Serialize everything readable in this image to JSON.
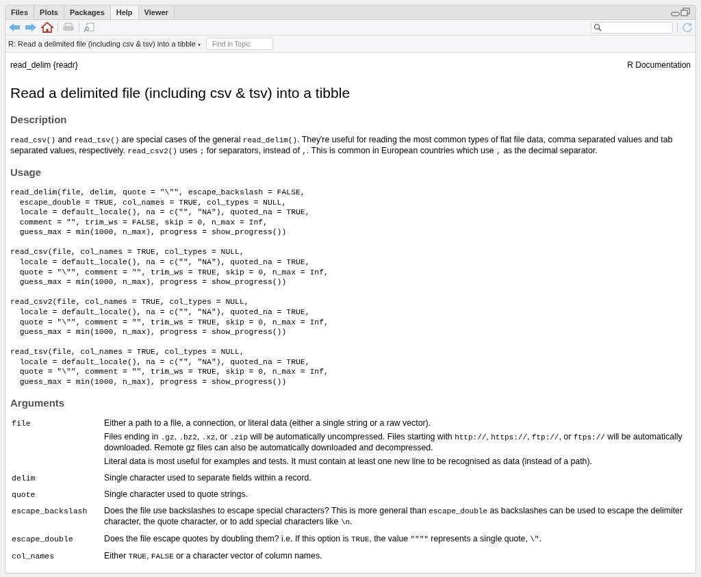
{
  "tabs": [
    {
      "label": "Files",
      "selected": false
    },
    {
      "label": "Plots",
      "selected": false
    },
    {
      "label": "Packages",
      "selected": false
    },
    {
      "label": "Help",
      "selected": true
    },
    {
      "label": "Viewer",
      "selected": false
    }
  ],
  "topic_bar": {
    "topic": "R: Read a delimited file (including csv & tsv) into a tibble",
    "caret": "▾",
    "find_placeholder": "Find in Topic"
  },
  "doc": {
    "header_left": "read_delim {readr}",
    "header_right": "R Documentation",
    "title": "Read a delimited file (including csv & tsv) into a tibble",
    "sections": [
      {
        "kind": "text",
        "heading": "Description",
        "paragraphs": [
          [
            {
              "text": "read_csv()",
              "code": true
            },
            {
              "text": " and ",
              "code": false
            },
            {
              "text": "read_tsv()",
              "code": true
            },
            {
              "text": " are special cases of the general ",
              "code": false
            },
            {
              "text": "read_delim()",
              "code": true
            },
            {
              "text": ". They're useful for reading the most common types of flat file data, comma separated values and tab separated values, respectively. ",
              "code": false
            },
            {
              "text": "read_csv2()",
              "code": true
            },
            {
              "text": " uses ",
              "code": false
            },
            {
              "text": ";",
              "code": true
            },
            {
              "text": " for separators, instead of ",
              "code": false
            },
            {
              "text": ",",
              "code": true
            },
            {
              "text": ". This is common in European countries which use ",
              "code": false
            },
            {
              "text": ",",
              "code": true
            },
            {
              "text": " as the decimal separator.",
              "code": false
            }
          ]
        ]
      },
      {
        "kind": "usage",
        "heading": "Usage",
        "blocks": [
          [
            "read_delim(file, delim, quote = \"\\\"\", escape_backslash = FALSE,",
            "  escape_double = TRUE, col_names = TRUE, col_types = NULL,",
            "  locale = default_locale(), na = c(\"\", \"NA\"), quoted_na = TRUE,",
            "  comment = \"\", trim_ws = FALSE, skip = 0, n_max = Inf,",
            "  guess_max = min(1000, n_max), progress = show_progress())"
          ],
          [
            "read_csv(file, col_names = TRUE, col_types = NULL,",
            "  locale = default_locale(), na = c(\"\", \"NA\"), quoted_na = TRUE,",
            "  quote = \"\\\"\", comment = \"\", trim_ws = TRUE, skip = 0, n_max = Inf,",
            "  guess_max = min(1000, n_max), progress = show_progress())"
          ],
          [
            "read_csv2(file, col_names = TRUE, col_types = NULL,",
            "  locale = default_locale(), na = c(\"\", \"NA\"), quoted_na = TRUE,",
            "  quote = \"\\\"\", comment = \"\", trim_ws = TRUE, skip = 0, n_max = Inf,",
            "  guess_max = min(1000, n_max), progress = show_progress())"
          ],
          [
            "read_tsv(file, col_names = TRUE, col_types = NULL,",
            "  locale = default_locale(), na = c(\"\", \"NA\"), quoted_na = TRUE,",
            "  quote = \"\\\"\", comment = \"\", trim_ws = TRUE, skip = 0, n_max = Inf,",
            "  guess_max = min(1000, n_max), progress = show_progress())"
          ]
        ]
      },
      {
        "kind": "arguments",
        "heading": "Arguments",
        "rows": [
          {
            "name": "file",
            "paragraphs": [
              [
                {
                  "text": "Either a path to a file, a connection, or literal data (either a single string or a raw vector).",
                  "code": false
                }
              ],
              [
                {
                  "text": "Files ending in ",
                  "code": false
                },
                {
                  "text": ".gz",
                  "code": true
                },
                {
                  "text": ", ",
                  "code": false
                },
                {
                  "text": ".bz2",
                  "code": true
                },
                {
                  "text": ", ",
                  "code": false
                },
                {
                  "text": ".xz",
                  "code": true
                },
                {
                  "text": ", or ",
                  "code": false
                },
                {
                  "text": ".zip",
                  "code": true
                },
                {
                  "text": " will be automatically uncompressed. Files starting with ",
                  "code": false
                },
                {
                  "text": "http://",
                  "code": true
                },
                {
                  "text": ", ",
                  "code": false
                },
                {
                  "text": "https://",
                  "code": true
                },
                {
                  "text": ", ",
                  "code": false
                },
                {
                  "text": "ftp://",
                  "code": true
                },
                {
                  "text": ", or ",
                  "code": false
                },
                {
                  "text": "ftps://",
                  "code": true
                },
                {
                  "text": " will be automatically downloaded. Remote gz files can also be automatically downloaded and decompressed.",
                  "code": false
                }
              ],
              [
                {
                  "text": "Literal data is most useful for examples and tests. It must contain at least one new line to be recognised as data (instead of a path).",
                  "code": false
                }
              ]
            ]
          },
          {
            "name": "delim",
            "paragraphs": [
              [
                {
                  "text": "Single character used to separate fields within a record.",
                  "code": false
                }
              ]
            ]
          },
          {
            "name": "quote",
            "paragraphs": [
              [
                {
                  "text": "Single character used to quote strings.",
                  "code": false
                }
              ]
            ]
          },
          {
            "name": "escape_backslash",
            "paragraphs": [
              [
                {
                  "text": "Does the file use backslashes to escape special characters? This is more general than ",
                  "code": false
                },
                {
                  "text": "escape_double",
                  "code": true
                },
                {
                  "text": " as backslashes can be used to escape the delimiter character, the quote character, or to add special characters like ",
                  "code": false
                },
                {
                  "text": "\\n",
                  "code": true
                },
                {
                  "text": ".",
                  "code": false
                }
              ]
            ]
          },
          {
            "name": "escape_double",
            "paragraphs": [
              [
                {
                  "text": "Does the file escape quotes by doubling them? i.e. If this option is ",
                  "code": false
                },
                {
                  "text": "TRUE",
                  "code": true
                },
                {
                  "text": ", the value ",
                  "code": false
                },
                {
                  "text": "\"\"\"\"",
                  "code": true
                },
                {
                  "text": " represents a single quote, ",
                  "code": false
                },
                {
                  "text": "\\\"",
                  "code": true
                },
                {
                  "text": ".",
                  "code": false
                }
              ]
            ]
          },
          {
            "name": "col_names",
            "paragraphs": [
              [
                {
                  "text": "Either ",
                  "code": false
                },
                {
                  "text": "TRUE",
                  "code": true
                },
                {
                  "text": ", ",
                  "code": false
                },
                {
                  "text": "FALSE",
                  "code": true
                },
                {
                  "text": " or a character vector of column names.",
                  "code": false
                }
              ]
            ]
          }
        ]
      }
    ]
  }
}
